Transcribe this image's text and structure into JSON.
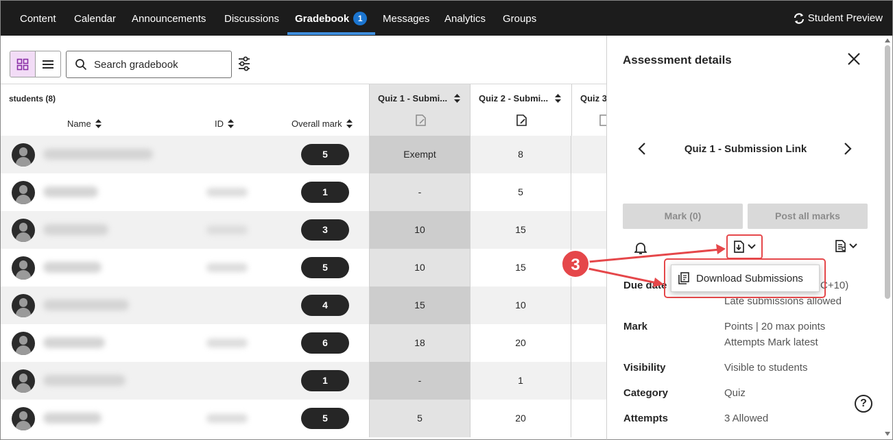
{
  "nav": {
    "items": [
      "Content",
      "Calendar",
      "Announcements",
      "Discussions",
      "Gradebook",
      "Messages",
      "Analytics",
      "Groups"
    ],
    "active": "Gradebook",
    "gradebook_badge": "1",
    "student_preview": "Student Preview",
    "accent_color": "#3e8ede"
  },
  "toolbar": {
    "search_placeholder": "Search gradebook",
    "grid_view_icon": "grid-icon",
    "list_view_icon": "list-icon",
    "filter_icon": "filter-sliders-icon"
  },
  "grid": {
    "students_count": "students (8)",
    "columns": {
      "name": "Name",
      "id": "ID",
      "overall": "Overall mark",
      "quiz1": "Quiz 1 - Submi...",
      "quiz2": "Quiz 2 - Submi...",
      "quiz3": "Quiz 3"
    },
    "rows": [
      {
        "overall": "5",
        "quiz1": "Exempt",
        "quiz2": "8"
      },
      {
        "overall": "1",
        "quiz1": "-",
        "quiz2": "5"
      },
      {
        "overall": "3",
        "quiz1": "10",
        "quiz2": "15"
      },
      {
        "overall": "5",
        "quiz1": "10",
        "quiz2": "15"
      },
      {
        "overall": "4",
        "quiz1": "15",
        "quiz2": "10"
      },
      {
        "overall": "6",
        "quiz1": "18",
        "quiz2": "20"
      },
      {
        "overall": "1",
        "quiz1": "-",
        "quiz2": "1"
      },
      {
        "overall": "5",
        "quiz1": "5",
        "quiz2": "20"
      }
    ]
  },
  "panel": {
    "title": "Assessment details",
    "assessment_name": "Quiz 1 - Submission Link",
    "mark_button": "Mark (0)",
    "post_button": "Post all marks",
    "due_label": "Due date",
    "due_value_tail": "C+10)",
    "late_value": "Late submissions allowed",
    "mark_label": "Mark",
    "mark_value_1": "Points | 20 max points",
    "mark_value_2": "Attempts Mark latest",
    "visibility_label": "Visibility",
    "visibility_value": "Visible to students",
    "category_label": "Category",
    "category_value": "Quiz",
    "attempts_label": "Attempts",
    "attempts_value": "3 Allowed",
    "help": "?"
  },
  "dropdown": {
    "download_submissions": "Download Submissions"
  },
  "callout": {
    "number": "3",
    "color": "#e5474a"
  }
}
